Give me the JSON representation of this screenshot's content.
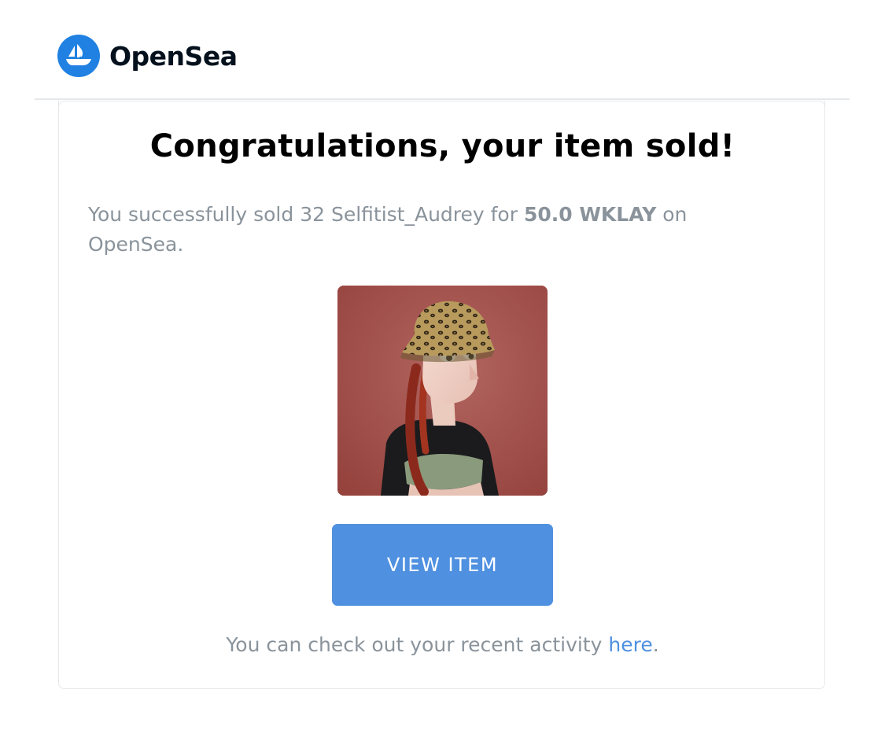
{
  "header": {
    "brand": "OpenSea",
    "logo_icon": "opensea-ship-icon",
    "logo_color": "#2081e2"
  },
  "email": {
    "headline": "Congratulations, your item sold!",
    "message_prefix": "You successfully sold 32 Selfitist_Audrey for ",
    "amount": "50.0 WKLAY",
    "message_suffix": " on OpenSea.",
    "item_image": "nft-avatar-image",
    "button_label": "VIEW ITEM",
    "button_color": "#4f90e0",
    "footer_prefix": "You can check out your recent activity ",
    "footer_link": "here",
    "footer_suffix": "."
  }
}
